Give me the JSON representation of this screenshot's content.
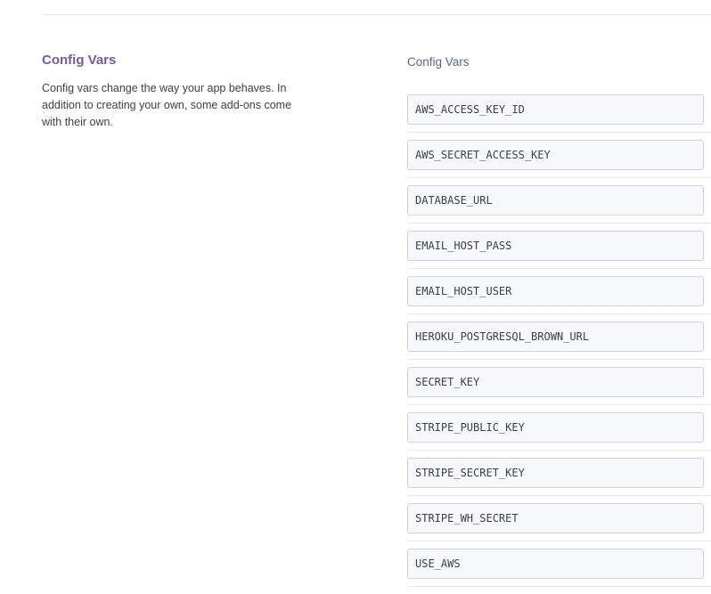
{
  "section": {
    "title": "Config Vars",
    "description": "Config vars change the way your app behaves. In addition to creating your own, some add-ons come with their own."
  },
  "config_vars": {
    "column_label": "Config Vars",
    "keys": [
      "AWS_ACCESS_KEY_ID",
      "AWS_SECRET_ACCESS_KEY",
      "DATABASE_URL",
      "EMAIL_HOST_PASS",
      "EMAIL_HOST_USER",
      "HEROKU_POSTGRESQL_BROWN_URL",
      "SECRET_KEY",
      "STRIPE_PUBLIC_KEY",
      "STRIPE_SECRET_KEY",
      "STRIPE_WH_SECRET",
      "USE_AWS"
    ]
  },
  "colors": {
    "title_purple": "#79589f",
    "input_bg": "#f7f8fb",
    "input_border": "#ccd3de"
  }
}
